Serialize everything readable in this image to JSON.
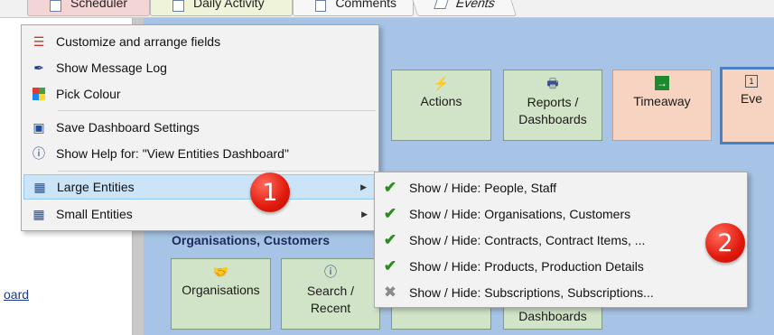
{
  "tabs": [
    "Scheduler",
    "Daily Activity",
    "Comments",
    "Events"
  ],
  "left_link": "oard",
  "dashboard": {
    "top_buttons": [
      {
        "label": "Actions",
        "icon": "lightning-icon"
      },
      {
        "label": "Reports / Dashboards",
        "icon": "printer-icon"
      },
      {
        "label": "Timeaway",
        "icon": "exit-icon"
      },
      {
        "label": "Eve",
        "icon": "calendar-icon"
      }
    ],
    "section_title": "Organisations, Customers",
    "bottom_buttons": [
      {
        "label": "Organisations",
        "icon": "handshake-icon"
      },
      {
        "label": "Search / Recent",
        "icon": "info-icon"
      },
      {
        "label": "Dashboards",
        "icon": ""
      }
    ]
  },
  "menu": {
    "items": [
      {
        "label": "Customize and arrange fields",
        "icon": "sliders-icon"
      },
      {
        "label": "Show Message Log",
        "icon": "pen-icon"
      },
      {
        "label": "Pick Colour",
        "icon": "palette-icon"
      },
      {
        "label": "Save Dashboard Settings",
        "icon": "floppy-disk-icon"
      },
      {
        "label": "Show Help for: \"View Entities Dashboard\"",
        "icon": "help-icon"
      },
      {
        "label": "Large Entities",
        "icon": "grid-icon"
      },
      {
        "label": "Small Entities",
        "icon": "grid-icon"
      }
    ]
  },
  "submenu": {
    "items": [
      {
        "label": "Show / Hide: People,  Staff",
        "checked": true
      },
      {
        "label": "Show / Hide: Organisations,  Customers",
        "checked": true
      },
      {
        "label": "Show / Hide: Contracts,  Contract Items,  ...",
        "checked": true
      },
      {
        "label": "Show / Hide: Products,  Production Details",
        "checked": true
      },
      {
        "label": "Show / Hide: Subscriptions,  Subscriptions...",
        "checked": false
      }
    ]
  },
  "badges": [
    "1",
    "2"
  ],
  "colors": {
    "dashboard_bg": "#a7c4e6",
    "green_button": "#d2e4c7",
    "orange_button": "#f7d4c1",
    "menu_highlight": "#cce4f7",
    "check": "#2e8b22",
    "badge": "#e01a0c"
  }
}
